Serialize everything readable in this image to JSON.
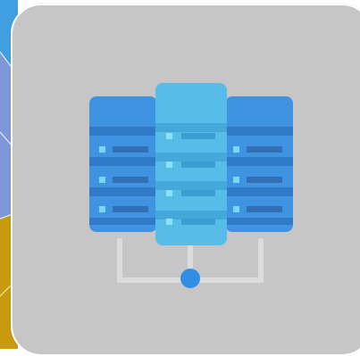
{
  "colors": {
    "tile_background": "#c6c6c6",
    "server_side": "#3f93e0",
    "server_side_dark": "#2f7bc8",
    "server_middle": "#57bde8",
    "server_middle_dark": "#44a8d9",
    "led": "#7bd6f2",
    "connector": "#dcdcdc",
    "node": "#2f8ee6",
    "edge_blue": "#3f9fe0",
    "edge_violet": "#7f97d8",
    "edge_gold": "#c99a0d"
  },
  "icons": {
    "main": "server-network-icon"
  }
}
